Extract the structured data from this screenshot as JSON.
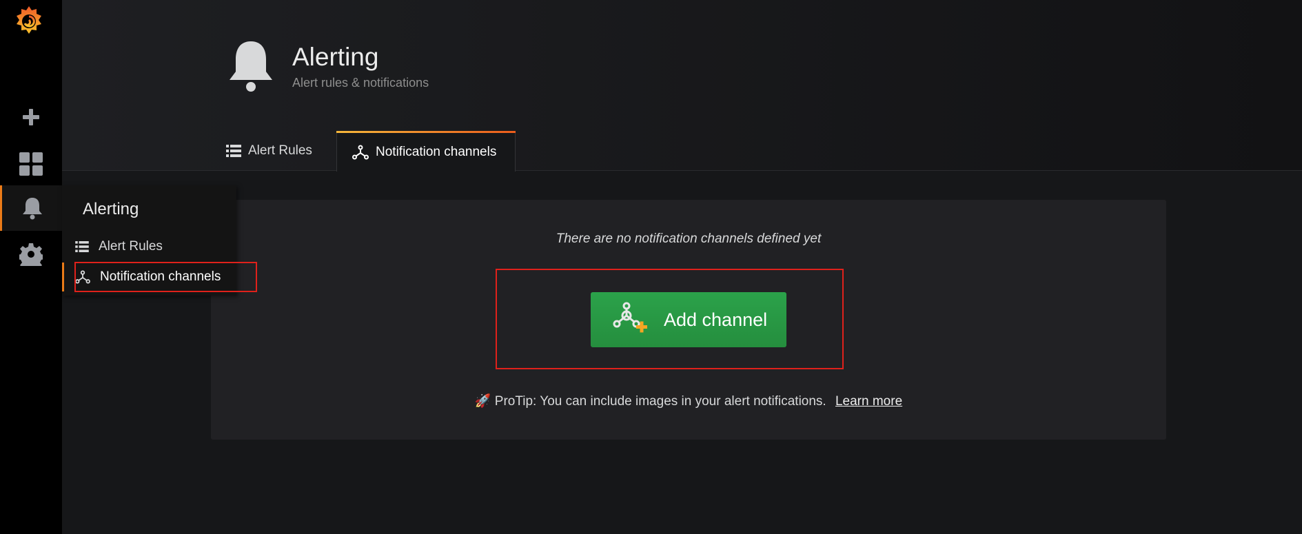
{
  "sidebar": {
    "logo": "grafana-logo",
    "items": [
      {
        "name": "create",
        "icon": "plus-icon"
      },
      {
        "name": "dashboards",
        "icon": "apps-icon"
      },
      {
        "name": "alerting",
        "icon": "bell-icon",
        "active": true
      },
      {
        "name": "configuration",
        "icon": "gear-icon"
      }
    ]
  },
  "flyout": {
    "title": "Alerting",
    "items": [
      {
        "label": "Alert Rules",
        "icon": "list-icon"
      },
      {
        "label": "Notification channels",
        "icon": "channels-icon",
        "active": true
      }
    ]
  },
  "header": {
    "icon": "bell-icon",
    "title": "Alerting",
    "subtitle": "Alert rules & notifications",
    "tabs": [
      {
        "label": "Alert Rules",
        "icon": "list-icon"
      },
      {
        "label": "Notification channels",
        "icon": "channels-icon",
        "active": true
      }
    ]
  },
  "main": {
    "empty_message": "There are no notification channels defined yet",
    "add_button_label": "Add channel",
    "protip_text": "ProTip: You can include images in your alert notifications.",
    "protip_link": "Learn more"
  },
  "colors": {
    "accent": "#eb7b18",
    "button_green": "#2ba24a",
    "highlight_red": "#e0211b",
    "sidebar_bg": "#000000",
    "page_bg": "#161719"
  }
}
